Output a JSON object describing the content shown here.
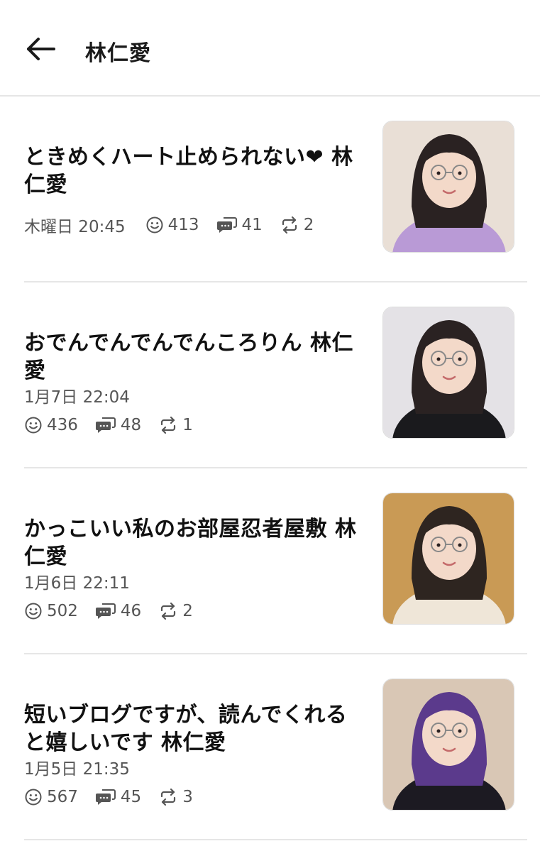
{
  "header": {
    "title": "林仁愛",
    "back_icon": "arrow-left-icon"
  },
  "posts": [
    {
      "title": "ときめくハート止められない❤ 林仁愛",
      "date": "木曜日 20:45",
      "reactions": "413",
      "comments": "41",
      "reblogs": "2",
      "meta_inline": true,
      "thumb_colors": [
        "#e9dfd6",
        "#b99ad6",
        "#2a2222"
      ]
    },
    {
      "title": "おでんでんでんでんころりん 林仁愛",
      "date": "1月7日 22:04",
      "reactions": "436",
      "comments": "48",
      "reblogs": "1",
      "meta_inline": false,
      "thumb_colors": [
        "#e4e2e6",
        "#1a1a1d",
        "#2a2222"
      ]
    },
    {
      "title": "かっこいい私のお部屋忍者屋敷 林仁愛",
      "date": "1月6日 22:11",
      "reactions": "502",
      "comments": "46",
      "reblogs": "2",
      "meta_inline": false,
      "thumb_colors": [
        "#c99a55",
        "#efe6d8",
        "#2e2520"
      ]
    },
    {
      "title": "短いブログですが、読んでくれると嬉しいです 林仁愛",
      "date": "1月5日 21:35",
      "reactions": "567",
      "comments": "45",
      "reblogs": "3",
      "meta_inline": false,
      "thumb_colors": [
        "#d9c7b5",
        "#1c1a22",
        "#5b3a8c"
      ]
    }
  ],
  "icons": {
    "reaction": "smiley-icon",
    "comment": "comment-icon",
    "reblog": "repeat-icon"
  },
  "colors": {
    "text": "#111111",
    "meta": "#555555",
    "divider": "#e6e6e6"
  }
}
